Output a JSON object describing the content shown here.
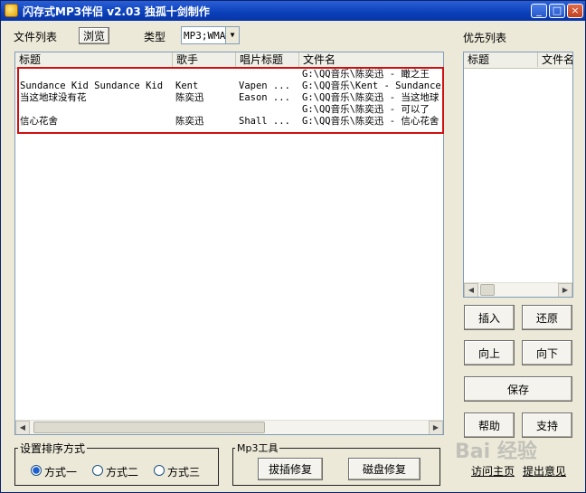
{
  "window": {
    "title": "闪存式MP3伴侣 v2.03 独孤十剑制作",
    "controls": {
      "minimize": "_",
      "maximize": "□",
      "close": "×"
    }
  },
  "toolbar": {
    "file_list_label": "文件列表",
    "browse_label": "浏览",
    "type_label": "类型",
    "type_value": "MP3;WMA"
  },
  "file_list": {
    "columns": [
      "标题",
      "歌手",
      "唱片标题",
      "文件名"
    ],
    "rows": [
      {
        "title": "",
        "artist": "",
        "album": "",
        "filename": "G:\\QQ音乐\\陈奕迅 - 瞰之王"
      },
      {
        "title": "Sundance Kid Sundance Kid",
        "artist": "Kent",
        "album": "Vapen ...",
        "filename": "G:\\QQ音乐\\Kent - Sundance"
      },
      {
        "title": "当这地球没有花",
        "artist": "陈奕迅",
        "album": "Eason ...",
        "filename": "G:\\QQ音乐\\陈奕迅 - 当这地球"
      },
      {
        "title": "",
        "artist": "",
        "album": "",
        "filename": "G:\\QQ音乐\\陈奕迅 - 可以了"
      },
      {
        "title": "信心花舍",
        "artist": "陈奕迅",
        "album": "Shall ...",
        "filename": "G:\\QQ音乐\\陈奕迅 - 信心花舍"
      }
    ]
  },
  "priority": {
    "label": "优先列表",
    "columns": [
      "标题",
      "文件名"
    ]
  },
  "buttons": {
    "insert": "插入",
    "restore": "还原",
    "up": "向上",
    "down": "向下",
    "save": "保存",
    "help": "帮助",
    "support": "支持"
  },
  "sort": {
    "label": "设置排序方式",
    "options": [
      "方式一",
      "方式二",
      "方式三"
    ],
    "selected": "方式一"
  },
  "mp3_tools": {
    "label": "Mp3工具",
    "plug_repair": "拔插修复",
    "disk_repair": "磁盘修复"
  },
  "links": {
    "homepage": "访问主页",
    "feedback": "提出意见"
  },
  "watermark": "Bai 经验",
  "colors": {
    "title_bar": "#0a3fb8",
    "highlight_box": "#d01010",
    "radio_selected": "#1e5fd0"
  }
}
